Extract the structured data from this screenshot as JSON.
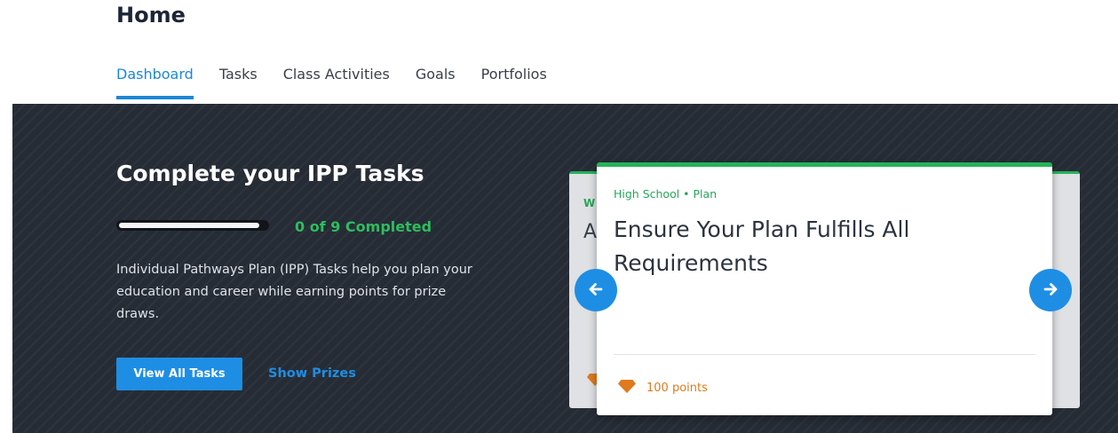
{
  "header": {
    "title": "Home"
  },
  "tabs": [
    {
      "label": "Dashboard",
      "active": true
    },
    {
      "label": "Tasks"
    },
    {
      "label": "Class Activities"
    },
    {
      "label": "Goals"
    },
    {
      "label": "Portfolios"
    }
  ],
  "ipp": {
    "title": "Complete your IPP Tasks",
    "progress_text": "0 of 9 Completed",
    "completed": 0,
    "total": 9,
    "description": "Individual Pathways Plan (IPP) Tasks help you plan your education and career while earning points for prize draws.",
    "view_all_label": "View All Tasks",
    "show_prizes_label": "Show Prizes"
  },
  "carousel": {
    "current_card": {
      "tag": "High School • Plan",
      "title": "Ensure Your Plan Fulfills All Requirements",
      "points_label": "100 points"
    },
    "background_card": {
      "tag_visible": "W",
      "title_visible": "A"
    },
    "prev_icon": "arrow-left-icon",
    "next_icon": "arrow-right-icon"
  },
  "colors": {
    "accent_blue": "#1e8ee4",
    "success_green": "#2ebd5e",
    "points_orange": "#e07a1f",
    "banner_dark": "#262c35"
  }
}
